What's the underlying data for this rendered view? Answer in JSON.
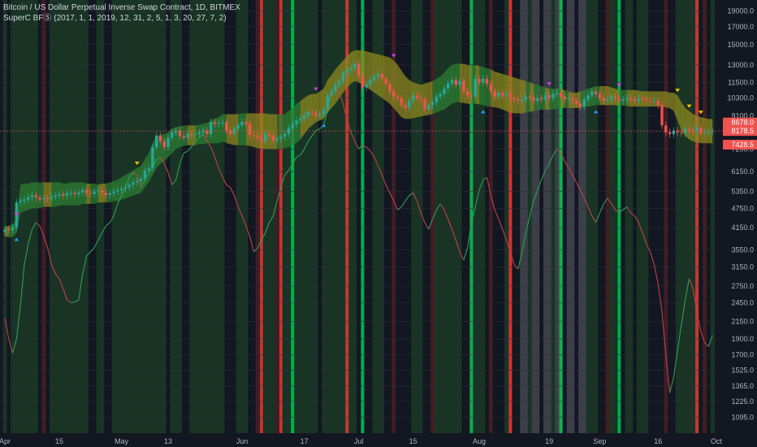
{
  "legend": {
    "symbol_line": "Bitcoin / US Dollar Perpetual Inverse Swap Contract, 1D, BITMEX",
    "indicator_line": "SuperC BFⓈ (2017, 1, 1, 2019, 12, 31, 2, 5, 1, 3, 20, 27, 7, 2)"
  },
  "colors": {
    "background": "#131722",
    "up_candle": "#26a69a",
    "down_candle": "#ef5350",
    "band_green": "#2e7d32",
    "band_yellow": "#8d8a1e",
    "band_red": "#8b2c2c",
    "bg_green": "#1b3a26",
    "bg_red": "#4a1e25",
    "bg_gray": "#45464f",
    "line_green": "#2e9e55",
    "line_red": "#c0404a",
    "signal_purple": "#c542e0",
    "signal_blue": "#2196f3"
  },
  "price_tags": [
    {
      "label": "8678.0",
      "price": 8678,
      "color": "#ef5350"
    },
    {
      "label": "8178.5",
      "price": 8178.5,
      "color": "#ef5350"
    },
    {
      "label": "7428.5",
      "price": 7428.5,
      "color": "#ef5350"
    }
  ],
  "chart_data": {
    "type": "line",
    "y_axis": {
      "scale": "log",
      "ticks": [
        19000,
        17000,
        15000,
        13000,
        11500,
        10300,
        9100,
        8100,
        7200,
        6150,
        5350,
        4750,
        4150,
        3550,
        3150,
        2750,
        2450,
        2150,
        1900,
        1700,
        1525,
        1365,
        1225,
        1095
      ],
      "tick_labels": [
        "19000.0",
        "17000.0",
        "15000.0",
        "13000.0",
        "11500.0",
        "10300.0",
        "9100.0",
        "8100.0",
        "7200.0",
        "6150.0",
        "5350.0",
        "4750.0",
        "4150.0",
        "3550.0",
        "3150.0",
        "2750.0",
        "2450.0",
        "2150.0",
        "1900.0",
        "1700.0",
        "1525.0",
        "1365.0",
        "1225.0",
        "1095.0"
      ],
      "range": [
        980,
        20500
      ]
    },
    "x_axis": {
      "tick_labels": [
        "Apr",
        "15",
        "May",
        "13",
        "Jun",
        "17",
        "Jul",
        "15",
        "Aug",
        "19",
        "Sep",
        "16",
        "Oct"
      ],
      "tick_days": [
        0,
        14,
        30,
        42,
        61,
        77,
        91,
        105,
        122,
        140,
        153,
        168,
        183
      ]
    },
    "close_prices": [
      4100,
      4080,
      4150,
      4950,
      5000,
      5050,
      5130,
      5200,
      5120,
      5050,
      5100,
      5080,
      5150,
      5200,
      5250,
      5190,
      5280,
      5300,
      5250,
      5320,
      5400,
      5280,
      5260,
      5350,
      5380,
      5300,
      5220,
      5280,
      5350,
      5400,
      5450,
      5500,
      5600,
      5700,
      5750,
      5850,
      6200,
      6300,
      7300,
      7900,
      7600,
      7300,
      7800,
      8100,
      8200,
      7900,
      7800,
      8000,
      7950,
      8000,
      8100,
      8200,
      8000,
      8700,
      8600,
      8650,
      8700,
      8200,
      8000,
      8300,
      8500,
      8700,
      8600,
      7950,
      7900,
      7800,
      7600,
      8000,
      7900,
      7650,
      7750,
      7850,
      8000,
      8350,
      8550,
      8800,
      8900,
      9100,
      9350,
      9300,
      9100,
      9200,
      9500,
      10500,
      10800,
      11300,
      11600,
      12300,
      12500,
      12700,
      13100,
      12000,
      11100,
      11300,
      11700,
      12000,
      12200,
      11800,
      11400,
      10800,
      10400,
      10300,
      9800,
      9600,
      10100,
      10500,
      10300,
      10200,
      9500,
      9800,
      10000,
      10400,
      10600,
      11000,
      11400,
      11700,
      11300,
      11600,
      10800,
      10500,
      10400,
      11800,
      11500,
      11800,
      11400,
      10800,
      10400,
      10700,
      10500,
      10600,
      10300,
      10200,
      10100,
      10200,
      10400,
      10350,
      10100,
      10300,
      10200,
      10500,
      10300,
      10600,
      10700,
      10400,
      10200,
      10300,
      10100,
      9900,
      9700,
      10200,
      10500,
      10800,
      10600,
      10300,
      10100,
      10200,
      10400,
      10300,
      10100,
      10200,
      10300,
      10200,
      10100,
      10300,
      10200,
      10100,
      10050,
      10100,
      9800,
      8500,
      8100,
      8000,
      8200,
      8100,
      8050,
      8300,
      8200,
      8150,
      8350,
      8050,
      8100,
      8150,
      8178.5
    ],
    "band_upper": [
      4180,
      4200,
      4250,
      4400,
      5600,
      5650,
      5650,
      5700,
      5700,
      5700,
      5700,
      5700,
      5700,
      5700,
      5700,
      5650,
      5650,
      5700,
      5700,
      5700,
      5700,
      5650,
      5650,
      5650,
      5600,
      5650,
      5650,
      5700,
      5750,
      5800,
      5900,
      6000,
      6100,
      6200,
      6300,
      6400,
      6700,
      7000,
      7500,
      7900,
      7950,
      8000,
      8100,
      8300,
      8400,
      8450,
      8500,
      8500,
      8500,
      8500,
      8550,
      8600,
      8650,
      8800,
      8900,
      9000,
      9200,
      9200,
      9200,
      9200,
      9200,
      9250,
      9250,
      9250,
      9250,
      9250,
      9250,
      9250,
      9200,
      9200,
      9200,
      9200,
      9200,
      9400,
      9600,
      9900,
      10100,
      10300,
      10500,
      10600,
      10600,
      10800,
      11000,
      11700,
      12100,
      12600,
      13000,
      13400,
      13800,
      14200,
      14400,
      14400,
      14400,
      14300,
      14200,
      14100,
      14000,
      13900,
      13800,
      13700,
      13400,
      13000,
      12500,
      12000,
      11700,
      11500,
      11400,
      11300,
      11400,
      11500,
      11600,
      11800,
      12000,
      12300,
      12700,
      13000,
      13100,
      13100,
      13100,
      13000,
      12900,
      13000,
      12900,
      12800,
      12700,
      12600,
      12400,
      12300,
      12200,
      12100,
      12000,
      11900,
      11800,
      11700,
      11600,
      11500,
      11400,
      11300,
      11200,
      11100,
      11000,
      11000,
      11000,
      11000,
      10900,
      10800,
      10700,
      10700,
      10800,
      10900,
      11000,
      11100,
      11200,
      11200,
      11200,
      11200,
      11100,
      11000,
      10900,
      10900,
      10900,
      10900,
      10900,
      10850,
      10800,
      10800,
      10800,
      10800,
      10800,
      10800,
      10800,
      10700,
      10700,
      10500,
      10000,
      9600,
      9400,
      9200,
      9100,
      9000,
      8950,
      8900,
      8900,
      8900,
      8850,
      8800,
      8750
    ],
    "band_lower": [
      3900,
      3880,
      3880,
      4000,
      4600,
      4650,
      4700,
      4750,
      4750,
      4750,
      4800,
      4800,
      4800,
      4800,
      4850,
      4850,
      4850,
      4850,
      4850,
      4850,
      4900,
      4900,
      4900,
      4900,
      4950,
      4950,
      4950,
      4950,
      5000,
      5000,
      5050,
      5100,
      5150,
      5200,
      5250,
      5300,
      5500,
      5700,
      6000,
      6300,
      6500,
      6600,
      6800,
      7000,
      7200,
      7300,
      7350,
      7400,
      7400,
      7400,
      7450,
      7450,
      7500,
      7500,
      7500,
      7500,
      7600,
      7500,
      7450,
      7400,
      7400,
      7400,
      7400,
      7350,
      7300,
      7250,
      7200,
      7200,
      7200,
      7200,
      7200,
      7200,
      7250,
      7300,
      7400,
      7500,
      7700,
      8000,
      8300,
      8500,
      8700,
      8800,
      8900,
      9300,
      9600,
      9900,
      10300,
      10700,
      11100,
      11400,
      11600,
      11500,
      11300,
      11100,
      10900,
      10700,
      10500,
      10300,
      10100,
      9900,
      9600,
      9300,
      9000,
      8900,
      8900,
      8950,
      9000,
      9050,
      9100,
      9150,
      9200,
      9300,
      9400,
      9500,
      9700,
      9900,
      10000,
      10000,
      9950,
      9900,
      9850,
      9900,
      9850,
      9800,
      9700,
      9700,
      9650,
      9600,
      9500,
      9400,
      9300,
      9250,
      9250,
      9250,
      9300,
      9350,
      9400,
      9450,
      9500,
      9500,
      9500,
      9500,
      9550,
      9600,
      9600,
      9600,
      9600,
      9600,
      9600,
      9650,
      9700,
      9750,
      9800,
      9800,
      9800,
      9800,
      9800,
      9800,
      9750,
      9750,
      9750,
      9700,
      9700,
      9700,
      9700,
      9700,
      9700,
      9700,
      9700,
      9700,
      9650,
      9600,
      9400,
      8800,
      8200,
      7900,
      7700,
      7600,
      7550,
      7500,
      7500,
      7500,
      7500,
      7500,
      7500,
      7500,
      7500
    ],
    "oscillator": [
      2200,
      1900,
      1720,
      1900,
      2400,
      3200,
      3700,
      4100,
      4300,
      4200,
      3900,
      3600,
      3200,
      3000,
      2900,
      2700,
      2500,
      2450,
      2460,
      2500,
      3000,
      3400,
      3500,
      3600,
      3800,
      4000,
      4200,
      4300,
      4500,
      4900,
      5200,
      5500,
      5900,
      6100,
      6000,
      5500,
      5800,
      6100,
      6300,
      6700,
      6800,
      6500,
      6100,
      5600,
      5800,
      6500,
      7000,
      7100,
      7300,
      7600,
      7800,
      8000,
      7600,
      7300,
      6800,
      6300,
      5900,
      5600,
      5500,
      5200,
      4800,
      4500,
      4200,
      3900,
      3500,
      3600,
      3800,
      4000,
      4300,
      4500,
      5000,
      5500,
      6000,
      6200,
      6500,
      6800,
      6900,
      7200,
      7600,
      7900,
      8200,
      8300,
      8500,
      9500,
      10600,
      11200,
      10800,
      9900,
      8800,
      8100,
      7600,
      7200,
      7400,
      7300,
      7100,
      6800,
      6400,
      6000,
      5600,
      5300,
      5000,
      4700,
      4800,
      5000,
      5200,
      5300,
      5000,
      4600,
      4300,
      4100,
      4400,
      4700,
      4900,
      4700,
      4400,
      4100,
      3800,
      3500,
      3300,
      3600,
      4300,
      4800,
      5400,
      5800,
      5900,
      5200,
      4700,
      4400,
      4100,
      3800,
      3500,
      3200,
      3100,
      3500,
      4000,
      4500,
      5000,
      5400,
      5800,
      6200,
      6500,
      6900,
      7200,
      7000,
      6600,
      6300,
      6000,
      5700,
      5400,
      5100,
      4800,
      4500,
      4300,
      4600,
      4900,
      5100,
      4900,
      4700,
      4600,
      4700,
      4800,
      4600,
      4500,
      4300,
      4000,
      3700,
      3500,
      3200,
      2800,
      2300,
      1700,
      1300,
      1450,
      1750,
      2100,
      2500,
      2900,
      2700,
      2300,
      2000,
      1850,
      1800,
      1950,
      2300,
      2500
    ]
  }
}
